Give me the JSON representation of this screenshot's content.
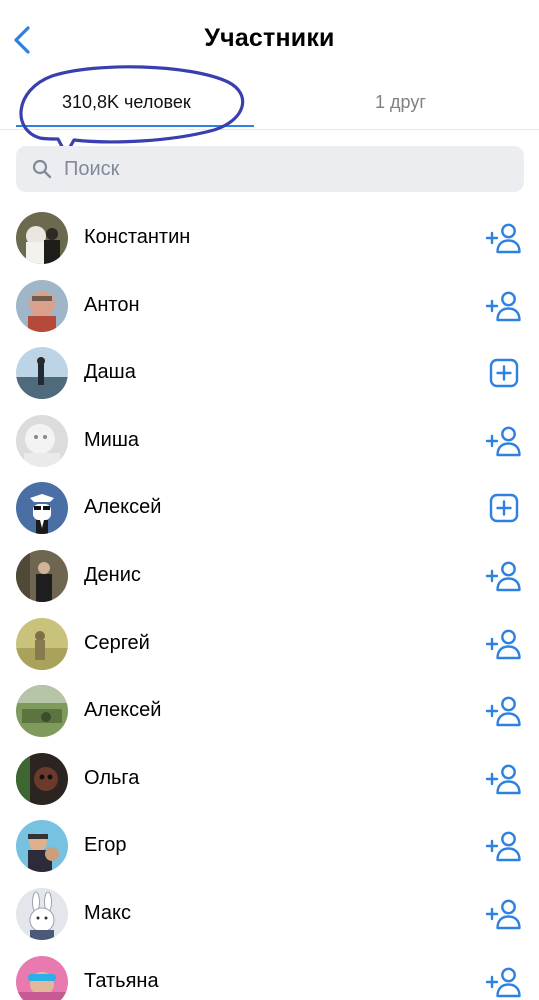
{
  "header": {
    "title": "Участники",
    "back_icon": "chevron-left-icon"
  },
  "tabs": [
    {
      "label": "310,8K человек",
      "active": true
    },
    {
      "label": "1 друг",
      "active": false
    }
  ],
  "search": {
    "placeholder": "Поиск",
    "icon": "search-icon"
  },
  "members": [
    {
      "name": "Константин",
      "action": "add-friend"
    },
    {
      "name": "Антон",
      "action": "add-friend"
    },
    {
      "name": "Даша",
      "action": "subscribe"
    },
    {
      "name": "Миша",
      "action": "add-friend"
    },
    {
      "name": "Алексей",
      "action": "subscribe"
    },
    {
      "name": "Денис",
      "action": "add-friend"
    },
    {
      "name": "Сергей",
      "action": "add-friend"
    },
    {
      "name": "Алексей",
      "action": "add-friend"
    },
    {
      "name": "Ольга",
      "action": "add-friend"
    },
    {
      "name": "Егор",
      "action": "add-friend"
    },
    {
      "name": "Макс",
      "action": "add-friend"
    },
    {
      "name": "Татьяна",
      "action": "add-friend"
    }
  ],
  "colors": {
    "accent": "#2d81e0",
    "annotation": "#3a3fb0",
    "search_bg": "#ebedf0",
    "secondary_text": "#828a99"
  }
}
